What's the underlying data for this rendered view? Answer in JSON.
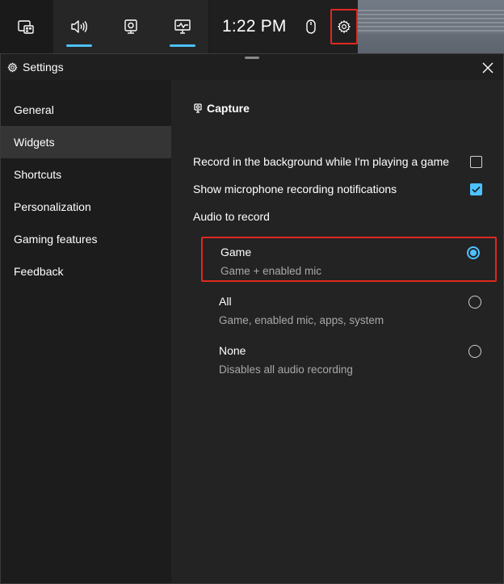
{
  "colors": {
    "accent": "#4cc2ff",
    "highlight_border": "#e0281f",
    "window_bg": "#1f1f1f",
    "sidebar_selected": "#353535"
  },
  "gamebar": {
    "icons": [
      "widget-home-icon",
      "audio-icon",
      "capture-icon",
      "performance-icon",
      "mouse-icon",
      "gear-icon"
    ],
    "time": "1:22 PM"
  },
  "settings": {
    "title": "Settings",
    "nav": [
      {
        "label": "General",
        "selected": false
      },
      {
        "label": "Widgets",
        "selected": true
      },
      {
        "label": "Shortcuts",
        "selected": false
      },
      {
        "label": "Personalization",
        "selected": false
      },
      {
        "label": "Gaming features",
        "selected": false
      },
      {
        "label": "Feedback",
        "selected": false
      }
    ],
    "capture": {
      "section_title": "Capture",
      "record_background": {
        "label": "Record in the background while I'm playing a game",
        "checked": false
      },
      "mic_notifications": {
        "label": "Show microphone recording notifications",
        "checked": true
      },
      "audio_label": "Audio to record",
      "audio_options": [
        {
          "title": "Game",
          "subtitle": "Game + enabled mic",
          "selected": true
        },
        {
          "title": "All",
          "subtitle": "Game, enabled mic, apps, system",
          "selected": false
        },
        {
          "title": "None",
          "subtitle": "Disables all audio recording",
          "selected": false
        }
      ]
    }
  }
}
